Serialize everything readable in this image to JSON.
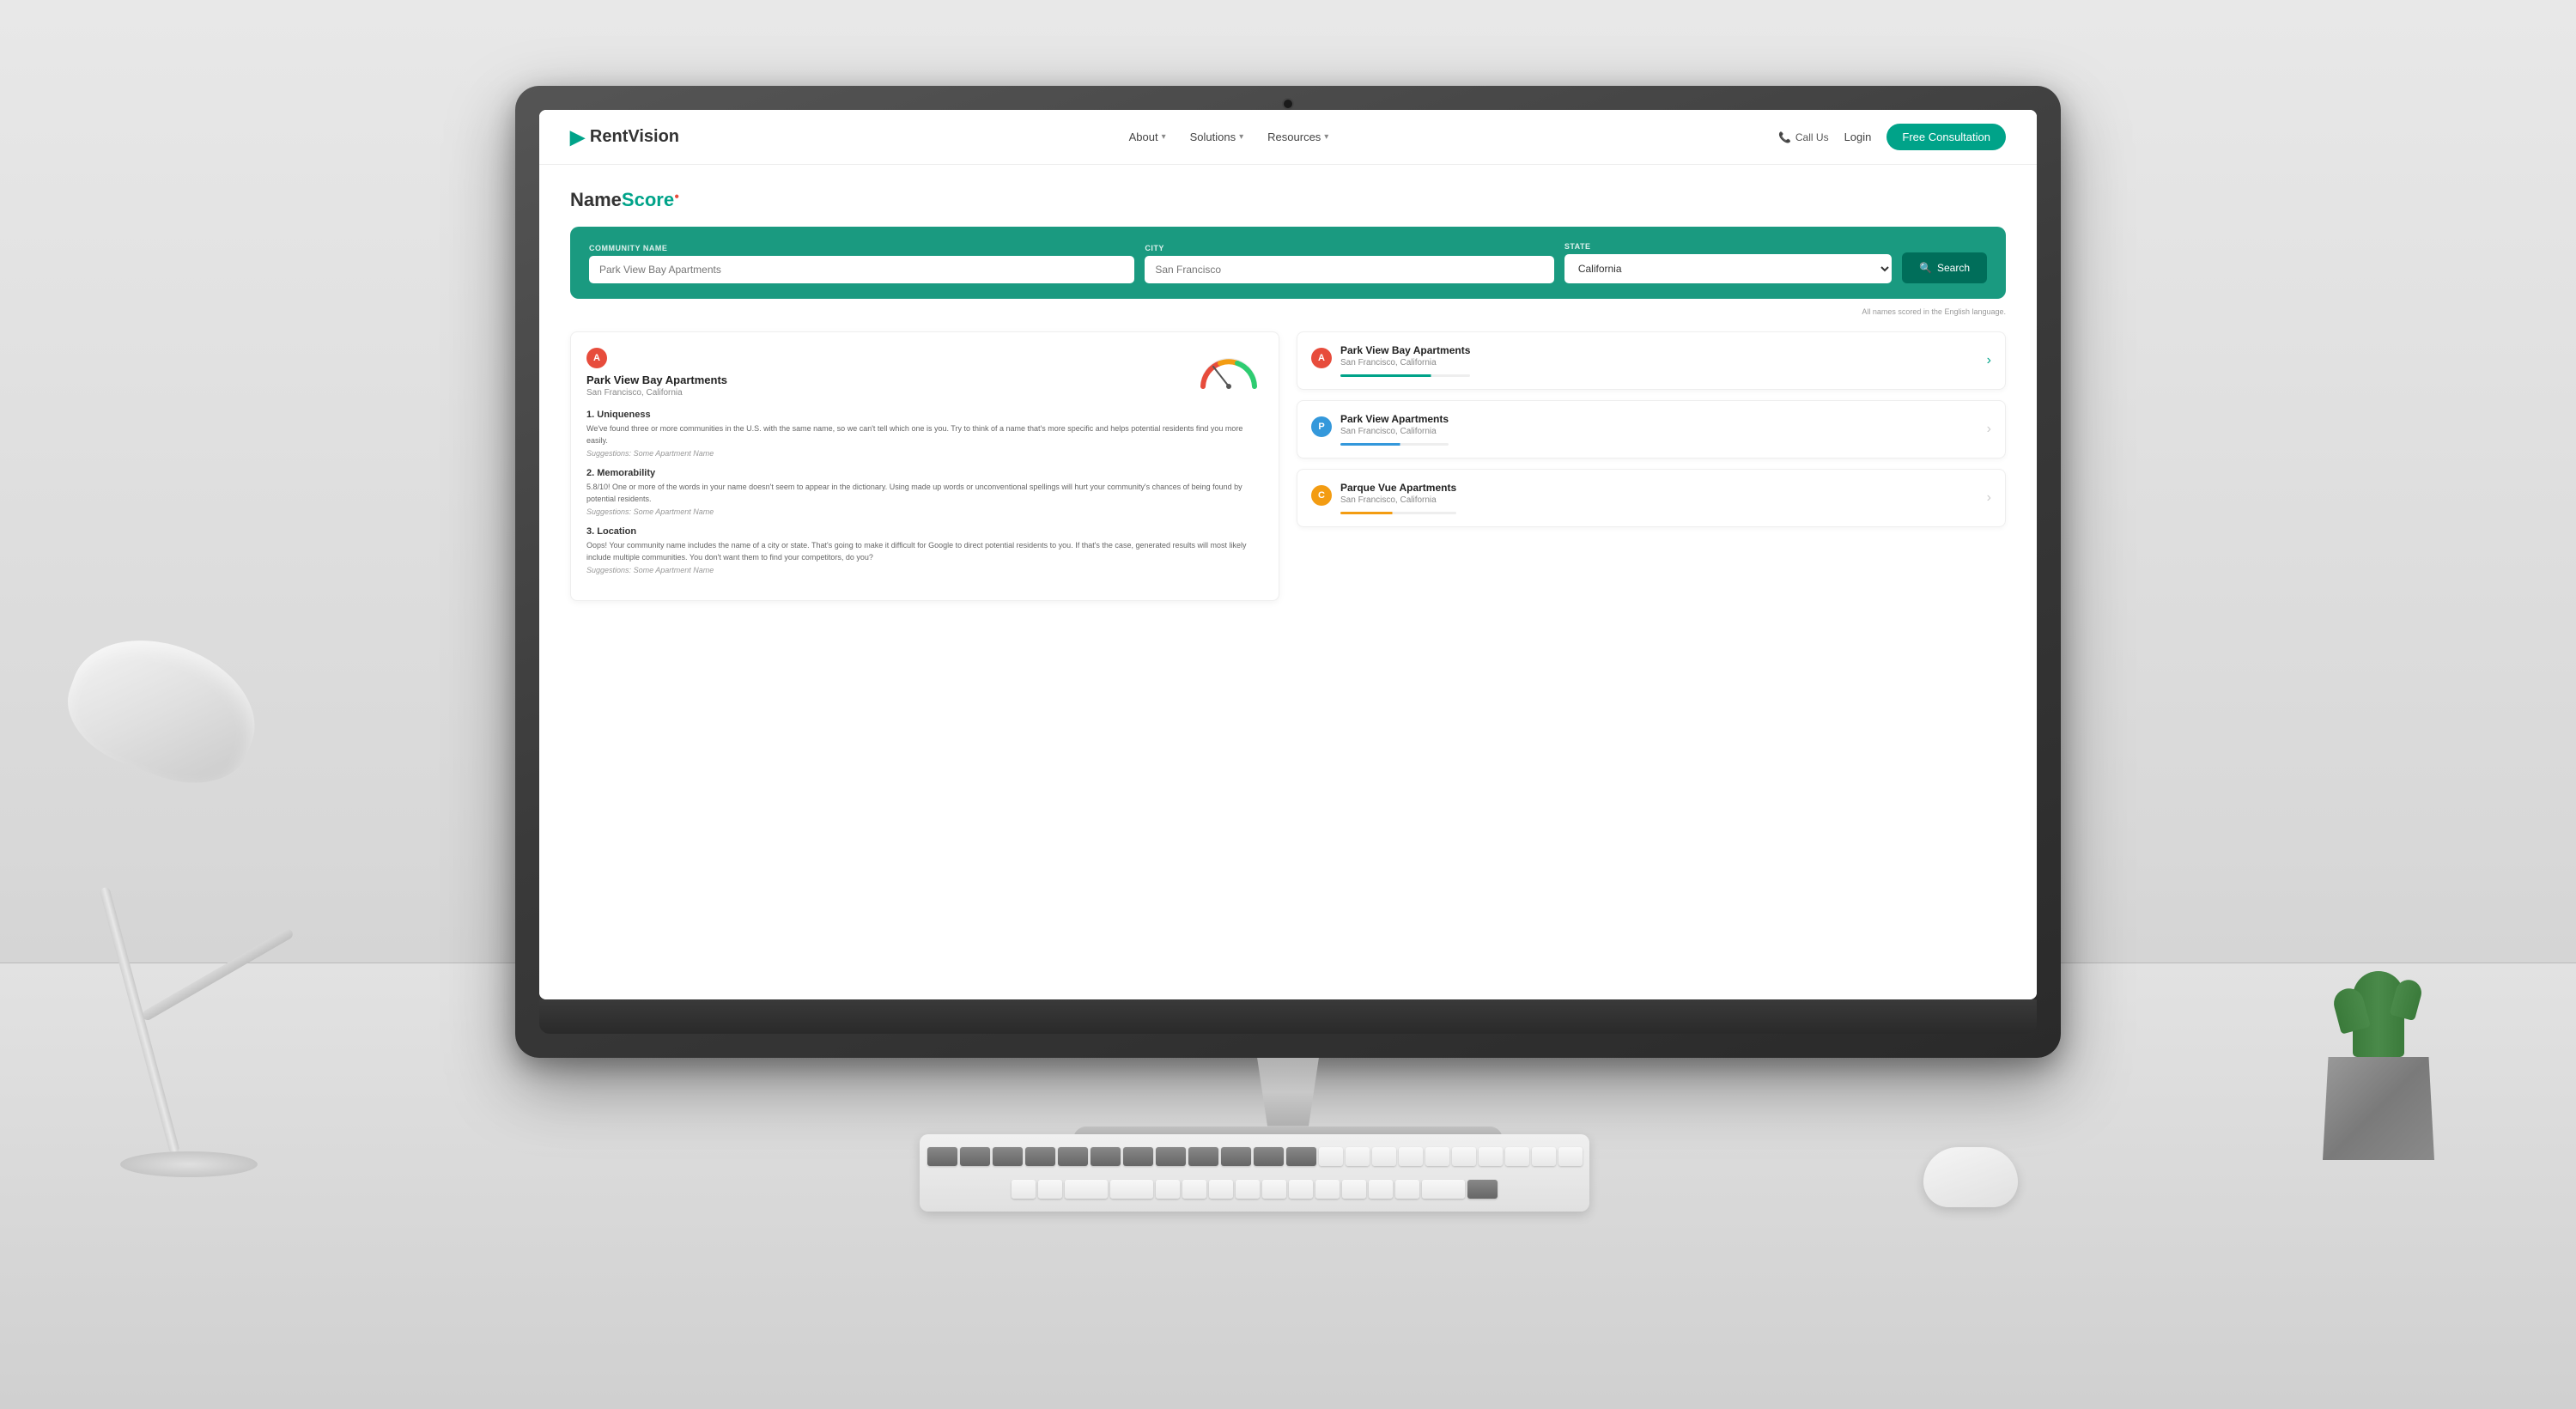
{
  "room": {
    "bg_color": "#e8e8e8",
    "desk_color": "#d8d8d8"
  },
  "monitor": {
    "apple_symbol": ""
  },
  "website": {
    "nav": {
      "logo_text": "RentVision",
      "logo_icon": "▶",
      "links": [
        {
          "label": "About",
          "has_arrow": true
        },
        {
          "label": "Solutions",
          "has_arrow": true
        },
        {
          "label": "Resources",
          "has_arrow": true
        }
      ],
      "call_label": "Call Us",
      "login_label": "Login",
      "cta_label": "Free Consultation"
    },
    "hero": {
      "logo_name": "NameScore",
      "logo_dot": "●"
    },
    "search": {
      "community_label": "COMMUNITY NAME",
      "community_placeholder": "Park View Bay Apartments",
      "city_label": "CITY",
      "city_placeholder": "San Francisco",
      "state_label": "STATE",
      "state_value": "California",
      "button_label": "Search",
      "disclaimer": "All names scored in the English language."
    },
    "results": {
      "left_panel": {
        "grade": "A",
        "name": "Park View Bay Apartments",
        "location": "San Francisco, California",
        "criteria": [
          {
            "number": "1.",
            "title": "Uniqueness",
            "body": "We've found three or more communities in the U.S. with the same name, so we can't tell which one is you. Try to think of a name that's more specific and helps potential residents find you more easily.",
            "suggestion_label": "Suggestions:",
            "suggestion_value": "Some Apartment Name"
          },
          {
            "number": "2.",
            "title": "Memorability",
            "body": "5.8/10! One or more of the words in your name doesn't seem to appear in the dictionary. Using made up words or unconventional spellings will hurt your community's chances of being found by potential residents.",
            "suggestion_label": "Suggestions:",
            "suggestion_value": "Some Apartment Name"
          },
          {
            "number": "3.",
            "title": "Location",
            "body": "Oops! Your community name includes the name of a city or state. That's going to make it difficult for Google to direct potential residents to you. If that's the case, generated results will most likely include multiple communities. You don't want them to find your competitors, do you?",
            "suggestion_label": "Suggestions:",
            "suggestion_value": "Some Apartment Name"
          }
        ]
      },
      "right_panel": {
        "items": [
          {
            "grade": "A",
            "grade_color": "red",
            "name": "Park View Bay Apartments",
            "location": "San Francisco, California",
            "bar_class": "green",
            "score_pct": 70,
            "active": true
          },
          {
            "grade": "P",
            "grade_color": "blue",
            "name": "Park View Apartments",
            "location": "San Francisco, California",
            "bar_class": "blue",
            "score_pct": 55,
            "active": false
          },
          {
            "grade": "C",
            "grade_color": "yellow",
            "name": "Parque Vue Apartments",
            "location": "San Francisco, California",
            "bar_class": "yellow",
            "score_pct": 45,
            "active": false
          }
        ]
      }
    }
  }
}
